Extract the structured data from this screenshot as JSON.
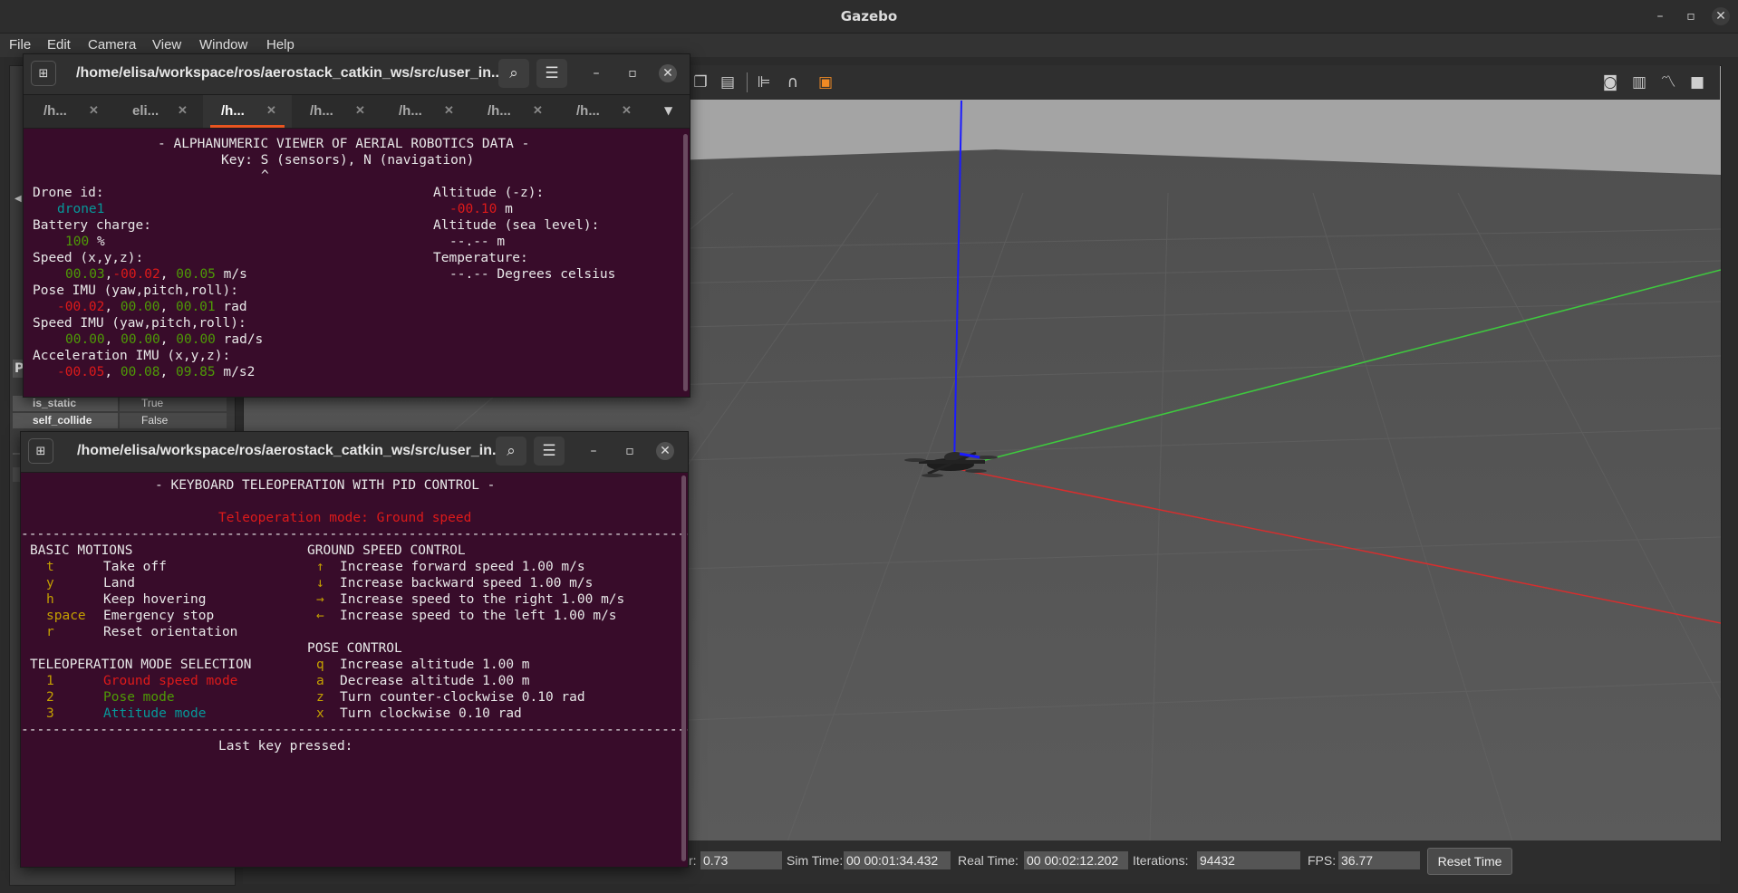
{
  "app": {
    "title": "Gazebo",
    "menu": [
      "File",
      "Edit",
      "Camera",
      "View",
      "Window",
      "Help"
    ],
    "window_controls": {
      "minimize": "–",
      "maximize": "▫",
      "close": "✕"
    }
  },
  "left_panel": {
    "header_fragment": "P",
    "properties": [
      {
        "key": "is_static",
        "checked": true,
        "value": "True"
      },
      {
        "key": "self_collide",
        "checked": false,
        "value": "False"
      }
    ]
  },
  "viewport": {
    "toolbar_icons": [
      "copy-icon",
      "paste-icon",
      "align-icon",
      "magnet-icon",
      "box-icon",
      "screenshot-icon",
      "log-icon",
      "plot-icon",
      "record-icon"
    ],
    "colors": {
      "z_axis": "#1b1bff",
      "y_axis": "#3ec93e",
      "x_axis": "#d62e2e",
      "sky": "#a4a4a4",
      "ground": "#585858"
    }
  },
  "status_bar": {
    "rtf_label_fragment": "r:",
    "rtf_value": "0.73",
    "sim_time_label": "Sim Time:",
    "sim_time_value": "00 00:01:34.432",
    "real_time_label": "Real Time:",
    "real_time_value": "00 00:02:12.202",
    "iterations_label": "Iterations:",
    "iterations_value": "94432",
    "fps_label": "FPS:",
    "fps_value": "36.77",
    "reset_time_label": "Reset Time"
  },
  "terminal_top": {
    "path": "/home/elisa/workspace/ros/aerostack_catkin_ws/src/user_in...",
    "tabs": [
      {
        "label": "/h...",
        "active": false
      },
      {
        "label": "eli...",
        "active": false
      },
      {
        "label": "/h...",
        "active": true
      },
      {
        "label": "/h...",
        "active": false
      },
      {
        "label": "/h...",
        "active": false
      },
      {
        "label": "/h...",
        "active": false
      },
      {
        "label": "/h...",
        "active": false
      }
    ],
    "title": "- ALPHANUMERIC VIEWER OF AERIAL ROBOTICS DATA -",
    "key_line": "Key: S (sensors), N (navigation)",
    "caret": "^",
    "drone_id_label": "Drone id:",
    "drone_id": "drone1",
    "battery_label": "Battery charge:",
    "battery_value": "100",
    "battery_unit": "%",
    "speed_label": "Speed (x,y,z):",
    "speed_x": "00.03",
    "speed_y": "-00.02",
    "speed_z": "00.05",
    "speed_unit": "m/s",
    "pose_label": "Pose IMU (yaw,pitch,roll):",
    "pose_yaw": "-00.02",
    "pose_pitch": "00.00",
    "pose_roll": "00.01",
    "pose_unit": "rad",
    "speed_imu_label": "Speed IMU (yaw,pitch,roll):",
    "speed_imu_yaw": "00.00",
    "speed_imu_pitch": "00.00",
    "speed_imu_roll": "00.00",
    "speed_imu_unit": "rad/s",
    "acc_label": "Acceleration IMU (x,y,z):",
    "acc_x": "-00.05",
    "acc_y": "00.08",
    "acc_z": "09.85",
    "acc_unit": "m/s2",
    "altitude_label": "Altitude (-z):",
    "altitude_value": "-00.10",
    "altitude_unit": "m",
    "sea_label": "Altitude (sea level):",
    "sea_value": "--.--",
    "sea_unit": "m",
    "temp_label": "Temperature:",
    "temp_value": "--.--",
    "temp_unit": "Degrees celsius"
  },
  "terminal_bottom": {
    "path": "/home/elisa/workspace/ros/aerostack_catkin_ws/src/user_in...",
    "title": "- KEYBOARD TELEOPERATION WITH PID CONTROL -",
    "mode_line": "Teleoperation mode: Ground speed",
    "separator": "----------------------------------------------------------------------------------------",
    "basic_motions_title": "BASIC MOTIONS",
    "basic_motions": [
      {
        "key": "t",
        "desc": "Take off"
      },
      {
        "key": "y",
        "desc": "Land"
      },
      {
        "key": "h",
        "desc": "Keep hovering"
      },
      {
        "key": "space",
        "desc": "Emergency stop"
      },
      {
        "key": "r",
        "desc": "Reset orientation"
      }
    ],
    "mode_selection_title": "TELEOPERATION MODE SELECTION",
    "modes": [
      {
        "key": "1",
        "desc": "Ground speed mode",
        "color": "#dd1a1a"
      },
      {
        "key": "2",
        "desc": "Pose mode",
        "color": "#4e9a06"
      },
      {
        "key": "3",
        "desc": "Attitude mode",
        "color": "#06989a"
      }
    ],
    "ground_speed_title": "GROUND SPEED CONTROL",
    "ground_speed": [
      {
        "key": "↑",
        "desc": "Increase forward speed 1.00 m/s"
      },
      {
        "key": "↓",
        "desc": "Increase backward speed 1.00 m/s"
      },
      {
        "key": "→",
        "desc": "Increase speed to the right 1.00 m/s"
      },
      {
        "key": "←",
        "desc": "Increase speed to the left 1.00 m/s"
      }
    ],
    "pose_control_title": "POSE CONTROL",
    "pose_control": [
      {
        "key": "q",
        "desc": "Increase altitude 1.00 m"
      },
      {
        "key": "a",
        "desc": "Decrease altitude 1.00 m"
      },
      {
        "key": "z",
        "desc": "Turn counter-clockwise 0.10 rad"
      },
      {
        "key": "x",
        "desc": "Turn clockwise 0.10 rad"
      }
    ],
    "last_key_label": "Last key pressed:"
  }
}
